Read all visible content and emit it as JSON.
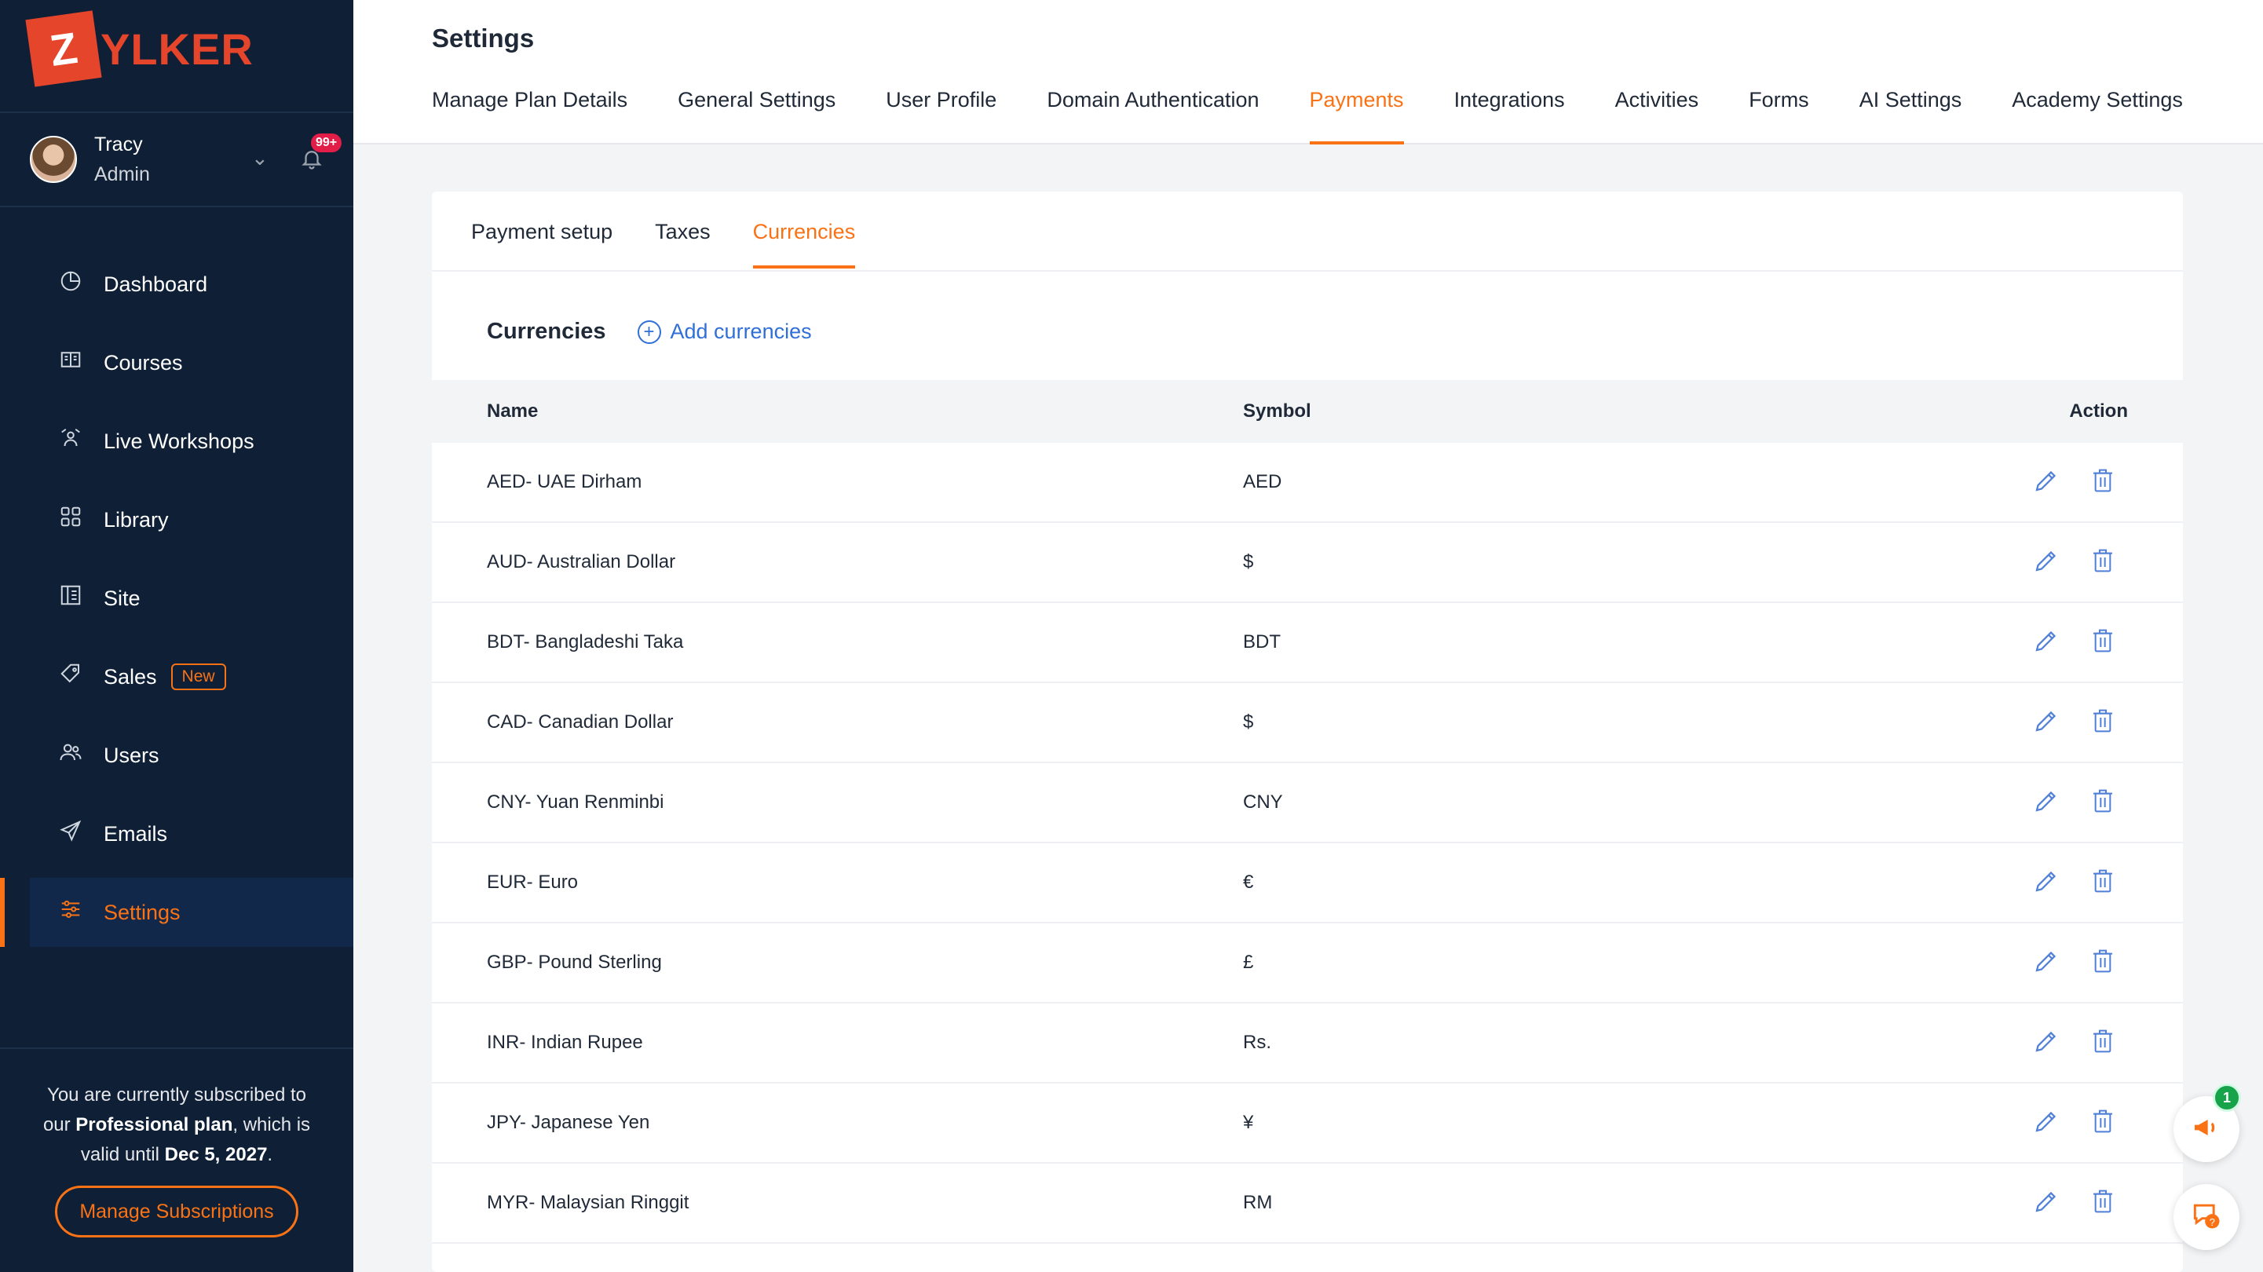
{
  "brand": {
    "logo_letter": "Z",
    "logo_rest": "YLKER",
    "accent": "#f97316",
    "logo_color": "#e5452b",
    "sidebar_bg": "#0f2036"
  },
  "user": {
    "name": "Tracy",
    "role": "Admin",
    "notification_count": "99+"
  },
  "sidebar": {
    "items": [
      {
        "label": "Dashboard",
        "icon": "pie-chart-icon"
      },
      {
        "label": "Courses",
        "icon": "book-icon"
      },
      {
        "label": "Live Workshops",
        "icon": "workshop-icon"
      },
      {
        "label": "Library",
        "icon": "grid-icon"
      },
      {
        "label": "Site",
        "icon": "layout-icon"
      },
      {
        "label": "Sales",
        "icon": "tag-icon",
        "tag": "New"
      },
      {
        "label": "Users",
        "icon": "users-icon"
      },
      {
        "label": "Emails",
        "icon": "send-icon"
      },
      {
        "label": "Settings",
        "icon": "sliders-icon",
        "active": true
      }
    ],
    "subscription": {
      "pre": "You are currently subscribed to our ",
      "plan": "Professional plan",
      "mid": ", which is valid until ",
      "date": "Dec 5, 2027",
      "post": "."
    },
    "manage_button": "Manage Subscriptions"
  },
  "header": {
    "title": "Settings",
    "tabs": [
      "Manage Plan Details",
      "General Settings",
      "User Profile",
      "Domain Authentication",
      "Payments",
      "Integrations",
      "Activities",
      "Forms",
      "AI Settings",
      "Academy Settings"
    ],
    "active_tab": "Payments"
  },
  "payments": {
    "subtabs": [
      "Payment setup",
      "Taxes",
      "Currencies"
    ],
    "active_subtab": "Currencies",
    "section_title": "Currencies",
    "add_label": "Add currencies",
    "columns": {
      "name": "Name",
      "symbol": "Symbol",
      "action": "Action"
    },
    "rows": [
      {
        "name": "AED- UAE Dirham",
        "symbol": "AED"
      },
      {
        "name": "AUD- Australian Dollar",
        "symbol": "$"
      },
      {
        "name": "BDT- Bangladeshi Taka",
        "symbol": "BDT"
      },
      {
        "name": "CAD- Canadian Dollar",
        "symbol": "$"
      },
      {
        "name": "CNY- Yuan Renminbi",
        "symbol": "CNY"
      },
      {
        "name": "EUR- Euro",
        "symbol": "€"
      },
      {
        "name": "GBP- Pound Sterling",
        "symbol": "£"
      },
      {
        "name": "INR- Indian Rupee",
        "symbol": "Rs."
      },
      {
        "name": "JPY- Japanese Yen",
        "symbol": "¥"
      },
      {
        "name": "MYR- Malaysian Ringgit",
        "symbol": "RM"
      }
    ]
  },
  "widgets": {
    "announcement_count": "1"
  }
}
